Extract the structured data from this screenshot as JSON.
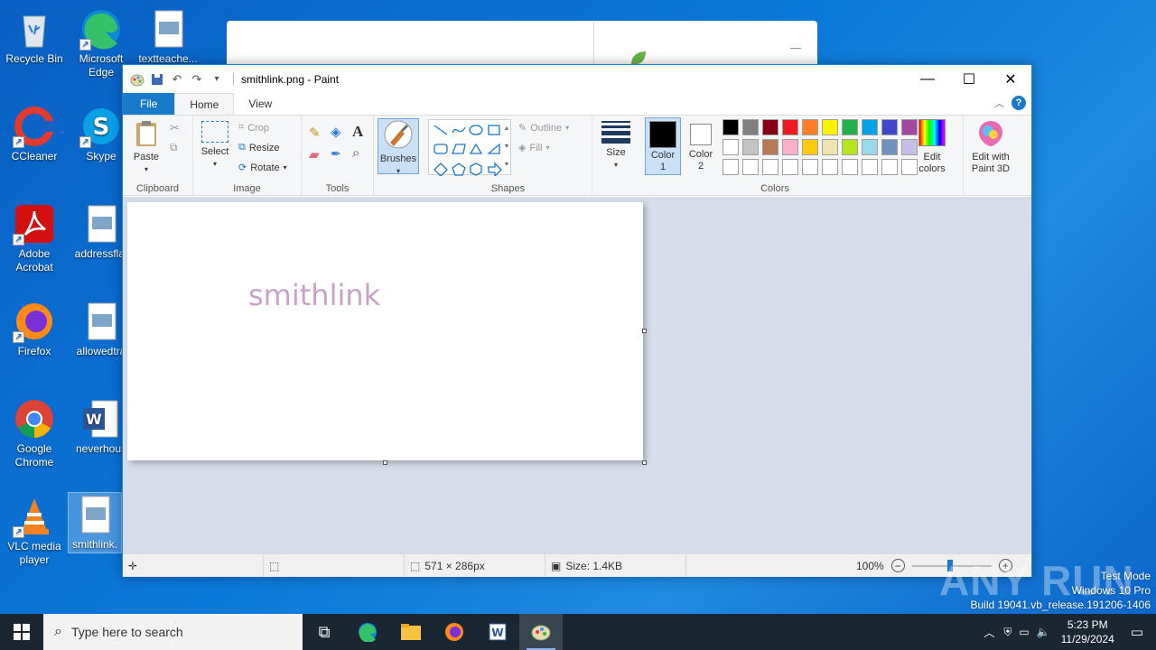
{
  "desktop": {
    "icons": [
      {
        "label": "Recycle Bin"
      },
      {
        "label": "Microsoft Edge"
      },
      {
        "label": "textteache..."
      },
      {
        "label": "CCleaner"
      },
      {
        "label": "Skype"
      },
      {
        "label": "Adobe Acrobat"
      },
      {
        "label": "addressflat"
      },
      {
        "label": "Firefox"
      },
      {
        "label": "allowedtra"
      },
      {
        "label": "Google Chrome"
      },
      {
        "label": "neverhous"
      },
      {
        "label": "VLC media player"
      },
      {
        "label": "smithlink."
      }
    ]
  },
  "paint": {
    "title": "smithlink.png - Paint",
    "tabs": {
      "file": "File",
      "home": "Home",
      "view": "View"
    },
    "ribbon": {
      "clipboard": {
        "label": "Clipboard",
        "paste": "Paste"
      },
      "image": {
        "label": "Image",
        "select": "Select",
        "crop": "Crop",
        "resize": "Resize",
        "rotate": "Rotate"
      },
      "tools": {
        "label": "Tools"
      },
      "brushes": {
        "label": "Brushes"
      },
      "shapes": {
        "label": "Shapes",
        "outline": "Outline",
        "fill": "Fill"
      },
      "size": {
        "label": "Size"
      },
      "colors": {
        "label": "Colors",
        "color1": "Color 1",
        "color2": "Color 2",
        "edit_colors": "Edit colors",
        "edit_paint3d": "Edit with Paint 3D",
        "color1_value": "#000000",
        "color2_value": "#ffffff",
        "palette_row1": [
          "#000000",
          "#7f7f7f",
          "#880015",
          "#ed1c24",
          "#ff7f27",
          "#fff200",
          "#22b14c",
          "#00a2e8",
          "#3f48cc",
          "#a349a4"
        ],
        "palette_row2": [
          "#ffffff",
          "#c3c3c3",
          "#b97a57",
          "#ffaec9",
          "#ffc90e",
          "#efe4b0",
          "#b5e61d",
          "#99d9ea",
          "#7092be",
          "#c8bfe7"
        ],
        "palette_row3": [
          "#ffffff",
          "#ffffff",
          "#ffffff",
          "#ffffff",
          "#ffffff",
          "#ffffff",
          "#ffffff",
          "#ffffff",
          "#ffffff",
          "#ffffff"
        ]
      }
    },
    "canvas": {
      "text": "smithlink",
      "text_color": "#c8a2c8"
    },
    "status": {
      "dimensions": "571 × 286px",
      "size": "Size: 1.4KB",
      "zoom": "100%"
    }
  },
  "taskbar": {
    "search_placeholder": "Type here to search",
    "time": "5:23 PM",
    "date": "11/29/2024"
  },
  "watermark": {
    "line1": "Test Mode",
    "line2": "Windows 10 Pro",
    "line3": "Build 19041.vb_release.191206-1406",
    "brand": "ANY RUN"
  }
}
